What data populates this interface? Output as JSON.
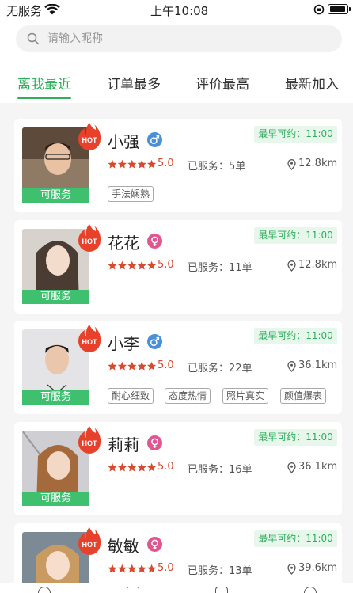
{
  "status_bar": {
    "carrier": "无服务",
    "time": "上午10:08"
  },
  "search": {
    "placeholder": "请输入昵称"
  },
  "tabs": [
    "离我最近",
    "订单最多",
    "评价最高",
    "最新加入"
  ],
  "active_tab": 0,
  "colors": {
    "accent": "#2fae5b",
    "available": "#3ec06f",
    "hot": "#e8412b",
    "male": "#4a90d9",
    "female": "#e0568e",
    "star": "#d84a2e"
  },
  "cards": [
    {
      "name": "小强",
      "gender": "male",
      "earliest": "最早可约：11:00",
      "rating": "5.0",
      "served": "已服务：5单",
      "distance": "12.8km",
      "status": "可服务",
      "hot": "HOT",
      "tags": [
        "手法娴熟"
      ]
    },
    {
      "name": "花花",
      "gender": "female",
      "earliest": "最早可约：11:00",
      "rating": "5.0",
      "served": "已服务：11单",
      "distance": "12.8km",
      "status": "可服务",
      "hot": "HOT",
      "tags": []
    },
    {
      "name": "小李",
      "gender": "male",
      "earliest": "最早可约：11:00",
      "rating": "5.0",
      "served": "已服务：22单",
      "distance": "36.1km",
      "status": "可服务",
      "hot": "HOT",
      "tags": [
        "耐心细致",
        "态度热情",
        "照片真实",
        "颜值爆表"
      ]
    },
    {
      "name": "莉莉",
      "gender": "female",
      "earliest": "最早可约：11:00",
      "rating": "5.0",
      "served": "已服务：16单",
      "distance": "36.1km",
      "status": "可服务",
      "hot": "HOT",
      "tags": []
    },
    {
      "name": "敏敏",
      "gender": "female",
      "earliest": "最早可约：11:00",
      "rating": "5.0",
      "served": "已服务：13单",
      "distance": "39.6km",
      "status": "",
      "hot": "HOT",
      "tags": []
    }
  ]
}
